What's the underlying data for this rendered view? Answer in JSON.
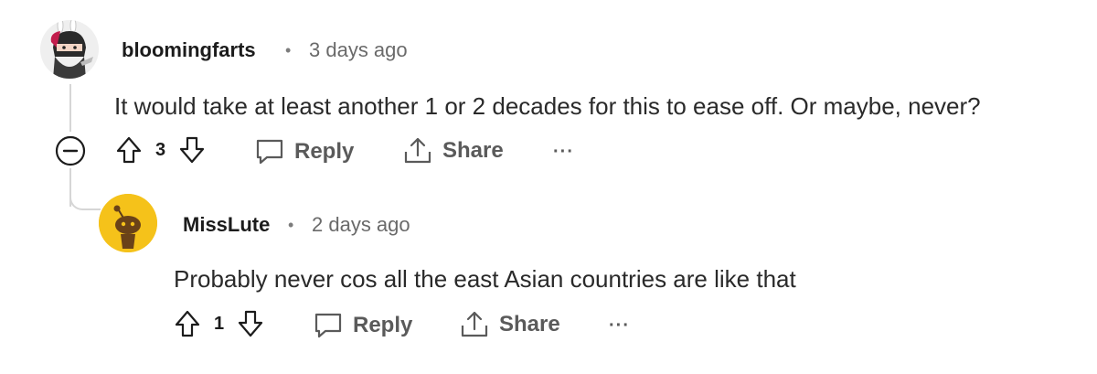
{
  "comments": [
    {
      "username": "bloomingfarts",
      "separator": "•",
      "time": "3 days ago",
      "body": "It would take at least another 1 or 2 decades for this to ease off. Or maybe, never?",
      "votes": "3",
      "reply_label": "Reply",
      "share_label": "Share",
      "more_label": "···",
      "collapse_symbol": "−"
    },
    {
      "username": "MissLute",
      "separator": "•",
      "time": "2 days ago",
      "body": "Probably never cos all the east Asian countries are like that",
      "votes": "1",
      "reply_label": "Reply",
      "share_label": "Share",
      "more_label": "···"
    }
  ],
  "colors": {
    "avatar2_bg": "#f5c21a",
    "thread_line": "#d6d6d6"
  }
}
